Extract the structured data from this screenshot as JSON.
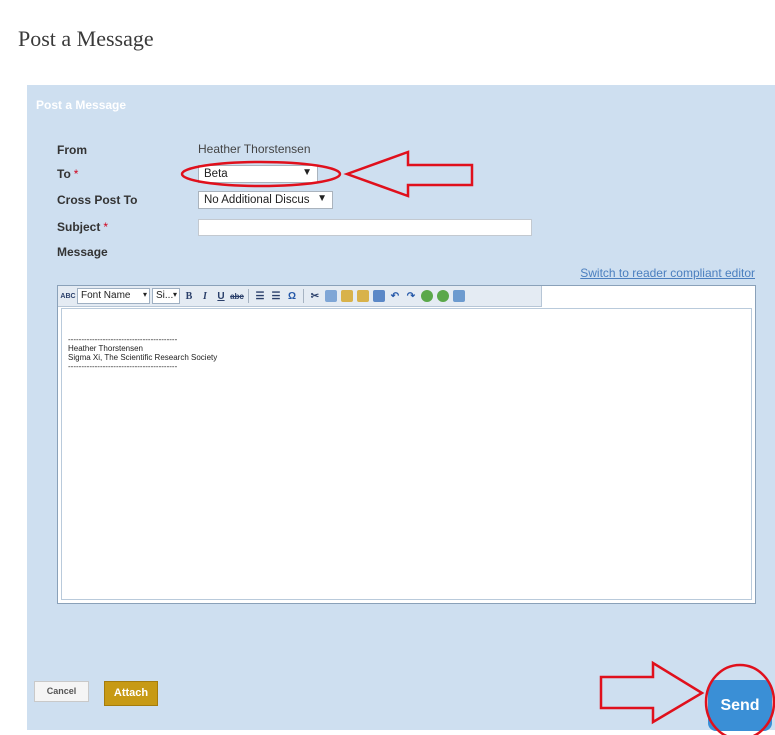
{
  "page": {
    "title": "Post a Message"
  },
  "panel": {
    "header": "Post a Message"
  },
  "form": {
    "from_label": "From",
    "from_value": "Heather Thorstensen",
    "to_label": "To",
    "required_mark": "*",
    "to_value": "Beta",
    "cross_post_label": "Cross Post To",
    "cross_post_value": "No Additional Discus",
    "subject_label": "Subject",
    "subject_value": "",
    "message_label": "Message"
  },
  "editor": {
    "switch_link": "Switch to reader compliant editor",
    "toolbar": {
      "font_name": "Font Name",
      "font_size": "Si..."
    },
    "content": {
      "divider": "-----------------------------------------",
      "line1": "Heather Thorstensen",
      "line2": "Sigma Xi, The Scientific Research Society"
    }
  },
  "actions": {
    "cancel_label": "Cancel",
    "attach_label": "Attach",
    "send_label": "Send"
  },
  "colors": {
    "panel_bg": "#cedff0",
    "attach_bg": "#c79a15",
    "send_bg": "#3a8fd6",
    "annotation_red": "#e0101c"
  },
  "icons": [
    "spellcheck-icon",
    "bold-icon",
    "italic-icon",
    "underline-icon",
    "strikethrough-icon",
    "ordered-list-icon",
    "unordered-list-icon",
    "special-char-icon",
    "cut-icon",
    "copy-icon",
    "paste-icon",
    "paste-text-icon",
    "paste-word-icon",
    "undo-icon",
    "redo-icon",
    "link-icon",
    "unlink-icon",
    "image-icon"
  ]
}
